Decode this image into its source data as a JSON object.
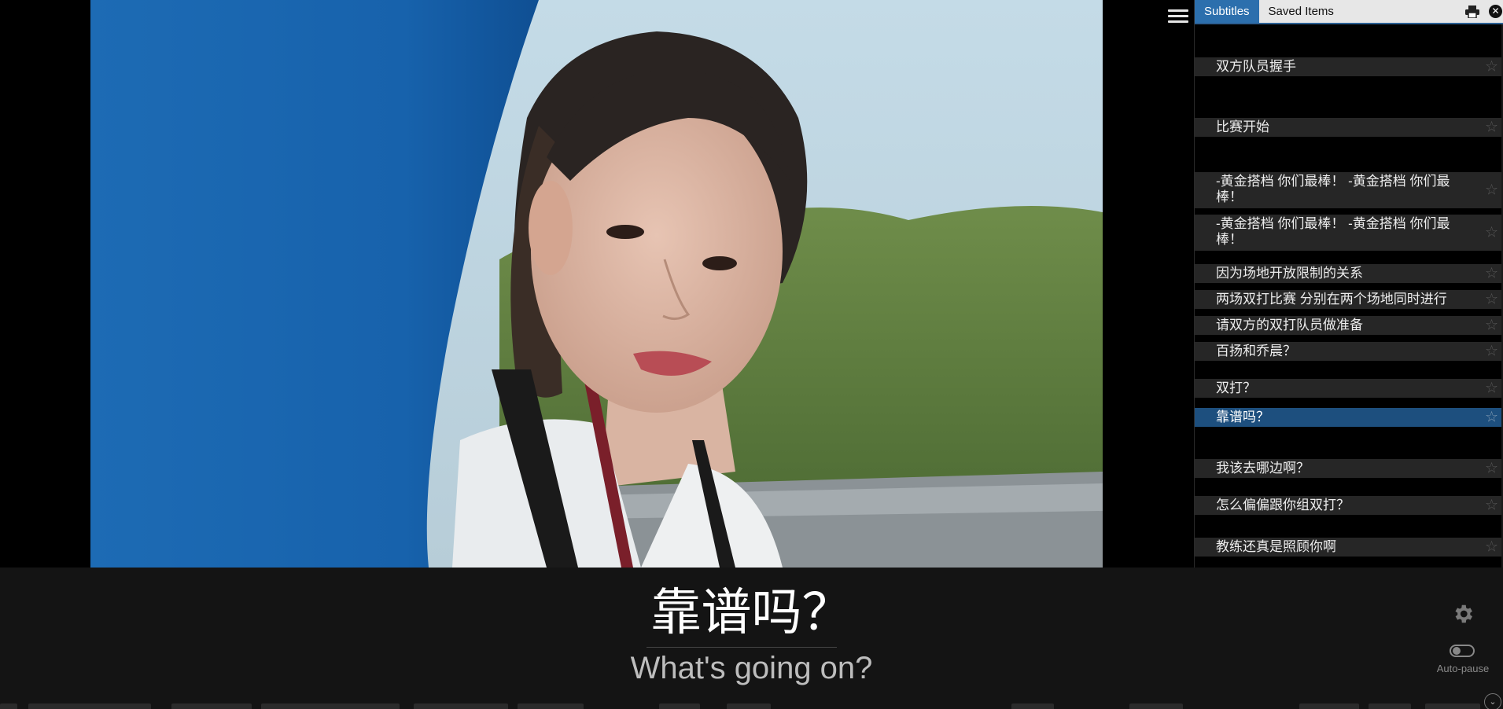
{
  "tabs": [
    {
      "label": "Subtitles"
    },
    {
      "label": "Saved Items"
    }
  ],
  "subtitles": [
    {
      "text": "双方队员握手"
    },
    {
      "text": "比赛开始"
    },
    {
      "text": "-黄金搭档 你们最棒！ -黄金搭档 你们最棒！"
    },
    {
      "text": "-黄金搭档 你们最棒！ -黄金搭档 你们最棒！"
    },
    {
      "text": "因为场地开放限制的关系"
    },
    {
      "text": "两场双打比赛 分别在两个场地同时进行"
    },
    {
      "text": "请双方的双打队员做准备"
    },
    {
      "text": "百扬和乔晨？"
    },
    {
      "text": "双打？"
    },
    {
      "text": "靠谱吗？"
    },
    {
      "text": "我该去哪边啊？"
    },
    {
      "text": "怎么偏偏跟你组双打？"
    },
    {
      "text": "教练还真是照顾你啊"
    }
  ],
  "active_subtitle_index": 9,
  "current_subtitle": {
    "primary": "靠谱吗？",
    "secondary": "What's going on?"
  },
  "controls": {
    "autopause_label": "Auto-pause",
    "autopause_on": false
  },
  "colors": {
    "active_tab": "#2c6fad",
    "active_row": "#1d4f7e",
    "row_bg": "#262626"
  },
  "icons": {
    "menu": "hamburger-icon",
    "print": "print-icon",
    "close": "close-icon",
    "star": "star-icon",
    "settings": "gear-icon"
  }
}
